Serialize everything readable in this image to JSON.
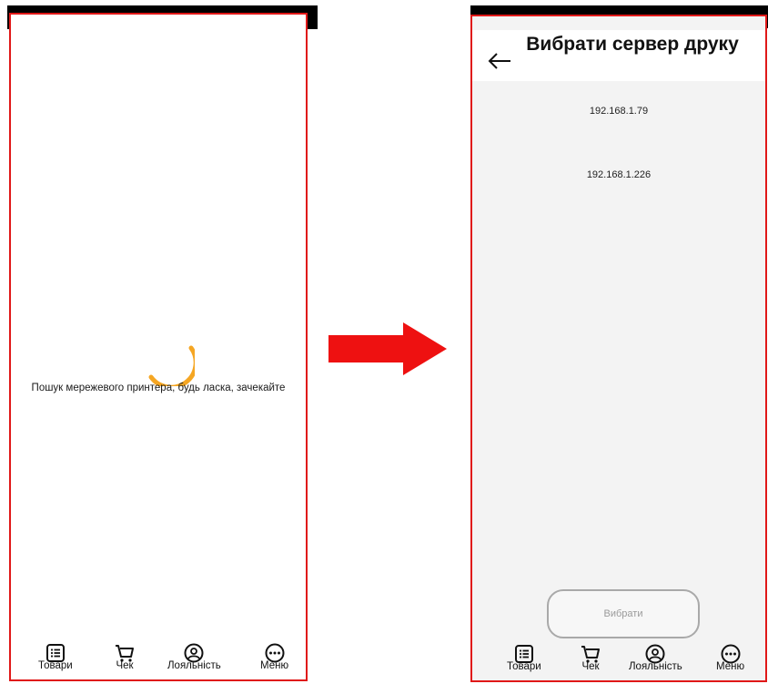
{
  "left_screen": {
    "loading_text": "Пошук мережевого принтера, будь ласка, зачекайте",
    "spinner_color": "#f5a623"
  },
  "right_screen": {
    "title": "Вибрати сервер друку",
    "servers": [
      "192.168.1.79",
      "192.168.1.226"
    ],
    "select_button_label": "Вибрати"
  },
  "bottom_nav": {
    "items": [
      {
        "label": "Товари",
        "icon": "list-icon"
      },
      {
        "label": "Чек",
        "icon": "cart-icon"
      },
      {
        "label": "Лояльність",
        "icon": "user-circle-icon"
      },
      {
        "label": "Меню",
        "icon": "more-circle-icon"
      }
    ]
  },
  "colors": {
    "frame_border": "#e01818",
    "arrow": "#ee1111",
    "status_bar": "#000000"
  }
}
